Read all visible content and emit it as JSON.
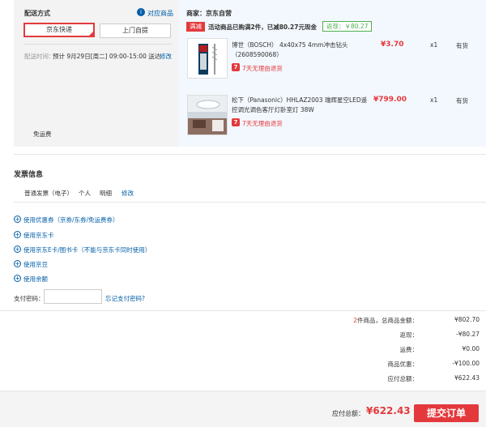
{
  "delivery": {
    "title": "配送方式",
    "stores_link": "对应商品",
    "options": [
      "京东快递",
      "上门自提"
    ],
    "time_label": "配送时间：",
    "time_value": "预计 9月29日[周二] 09:00-15:00 送达",
    "modify": "修改",
    "free_shipping": "免运费"
  },
  "order": {
    "seller": "商家：京东自营",
    "promo_tag": "满减",
    "promo_text": "活动商品已购满2件，已减80.27元现金",
    "rebate": "返现：￥80.27",
    "items": [
      {
        "name": "博世（BOSCH） 4x40x75 4mm冲击钻头（2608590068）",
        "price": "¥3.70",
        "qty": "x1",
        "stock": "有货",
        "policy": "7天无理由退货"
      },
      {
        "name": "松下（Panasonic）HHLAZ2003 瑞辉星空LED遥控调光调色客厅灯卧室灯 38W",
        "price": "¥799.00",
        "qty": "x1",
        "stock": "有货",
        "policy": "7天无理由退货"
      }
    ]
  },
  "invoice": {
    "title": "发票信息",
    "type": "普通发票（电子）",
    "person": "个人",
    "detail": "明细",
    "modify": "修改"
  },
  "payment": {
    "options": [
      "使用优惠券（京券/东券/免运费券）",
      "使用京东卡",
      "使用京东E卡/图书卡（不能与京东卡同时使用）",
      "使用京豆",
      "使用余额"
    ],
    "password_label": "支付密码：",
    "password_value": "",
    "forgot": "忘记支付密码?"
  },
  "summary": {
    "count": "2",
    "count_suffix": "件商品，总商品金额：",
    "total_goods": "¥802.70",
    "rebate_label": "返现：",
    "rebate": "-¥80.27",
    "freight_label": "运费：",
    "freight": "¥0.00",
    "discount_label": "商品优惠：",
    "discount": "-¥100.00",
    "payable_label": "应付总额：",
    "payable": "¥622.43"
  },
  "footer": {
    "payable_label": "应付总额：",
    "payable": "¥622.43",
    "submit": "提交订单"
  },
  "colors": {
    "accent": "#e4393c",
    "link": "#005ea7",
    "green": "#4caf50"
  }
}
